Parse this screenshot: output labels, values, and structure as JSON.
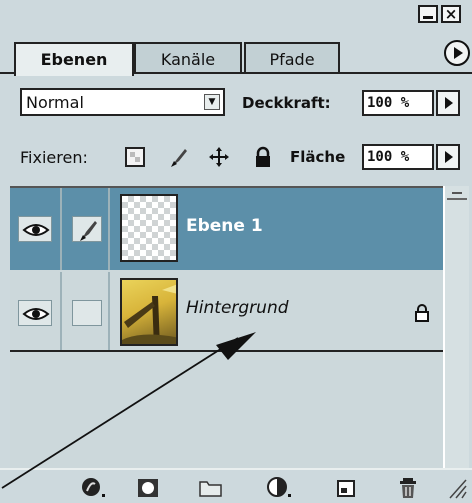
{
  "tabs": [
    {
      "label": "Ebenen",
      "active": true
    },
    {
      "label": "Kanäle",
      "active": false
    },
    {
      "label": "Pfade",
      "active": false
    }
  ],
  "blend_mode": {
    "value": "Normal"
  },
  "opacity": {
    "label": "Deckkraft:",
    "value": "100 %"
  },
  "lock": {
    "label": "Fixieren:",
    "icons": [
      "lock-transparency-icon",
      "lock-paint-icon",
      "lock-move-icon",
      "lock-all-icon"
    ]
  },
  "fill": {
    "label": "Fläche",
    "value": "100 %"
  },
  "layers": [
    {
      "name": "Ebene 1",
      "selected": true,
      "visible": true,
      "linked_brush": true
    },
    {
      "name": "Hintergrund",
      "selected": false,
      "visible": true,
      "locked": true
    }
  ],
  "bottom_toolbar": [
    "layer-style-icon",
    "add-mask-icon",
    "new-set-icon",
    "adjustment-layer-icon",
    "new-layer-icon",
    "trash-icon"
  ],
  "colors": {
    "panel": "#cdd9dd",
    "selection": "#5c8fa9",
    "annotation_arrow": "#111111"
  }
}
